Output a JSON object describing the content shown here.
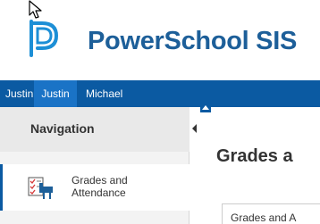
{
  "app": {
    "name": "PowerSchool SIS"
  },
  "tabs": [
    {
      "label": "Justin"
    },
    {
      "label": "Justin"
    },
    {
      "label": "Michael"
    }
  ],
  "sidebar": {
    "title": "Navigation",
    "items": [
      {
        "label": "Grades and Attendance",
        "icon": "grades-attendance-icon"
      }
    ]
  },
  "main": {
    "page_title": "Grades a",
    "sub_tab_label": "Grades and A"
  },
  "colors": {
    "brand_blue": "#0b5aa2",
    "active_tab": "#1a73c6",
    "logo_text": "#1d5f99"
  }
}
